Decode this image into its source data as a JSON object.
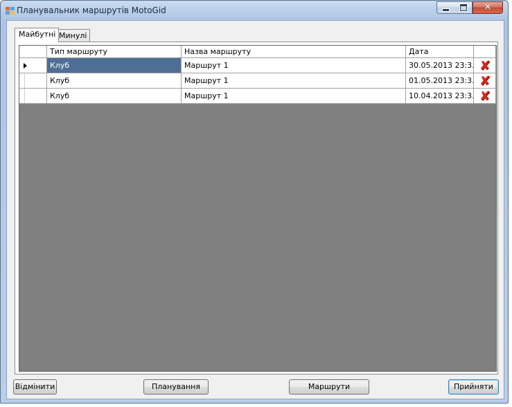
{
  "window": {
    "title": "Планувальник маршрутів MotoGid",
    "controls": {
      "minimize": "minimize",
      "maximize": "maximize",
      "close": "✕"
    }
  },
  "tabs": [
    {
      "label": "Майбутні",
      "active": true
    },
    {
      "label": "Минулі",
      "active": false
    }
  ],
  "grid": {
    "columns": {
      "type": "Тип маршруту",
      "name": "Назва маршруту",
      "date": "Дата"
    },
    "rows": [
      {
        "type": "Клуб",
        "name": "Маршрут 1",
        "date": "30.05.2013 23:3...",
        "current": true
      },
      {
        "type": "Клуб",
        "name": "Маршрут 1",
        "date": "01.05.2013 23:3...",
        "current": false
      },
      {
        "type": "Клуб",
        "name": "Маршрут 1",
        "date": "10.04.2013 23:3...",
        "current": false
      }
    ],
    "delete_icon": "red-x-delete-icon",
    "delete_glyph": "✘"
  },
  "buttons": {
    "cancel": "Відмінити",
    "plan": "Планування",
    "routes": "Маршрути",
    "accept": "Прийняти"
  },
  "colors": {
    "selection": "#4e6e95",
    "grid_background": "#808080",
    "delete_icon": "#d8251c"
  }
}
